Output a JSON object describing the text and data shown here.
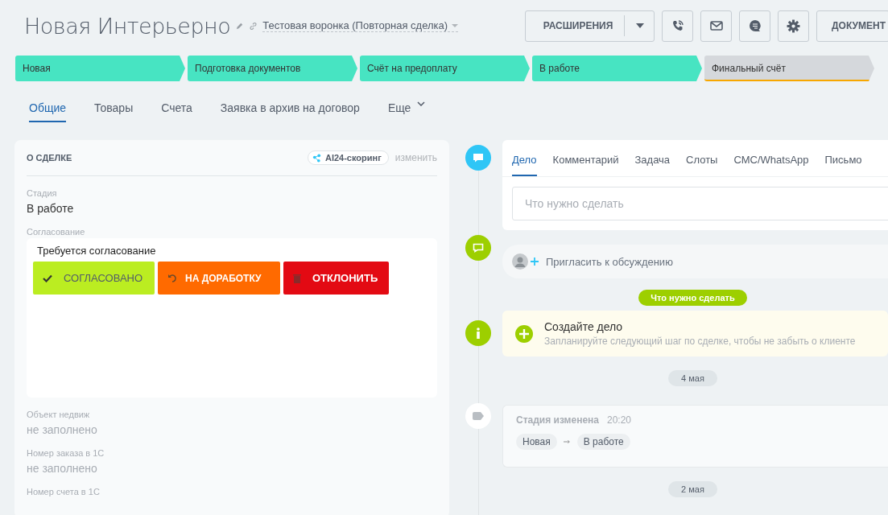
{
  "header": {
    "title": "Новая Интерьерно",
    "funnel": "Тестовая воронка (Повторная сделка)",
    "toolbar": [
      {
        "kind": "split",
        "label": "РАСШИРЕНИЯ"
      },
      {
        "kind": "phone"
      },
      {
        "kind": "mail"
      },
      {
        "kind": "chat"
      },
      {
        "kind": "settings"
      },
      {
        "kind": "text",
        "label": "ДОКУМЕНТ"
      }
    ]
  },
  "stages": [
    {
      "label": "Новая",
      "reached": true
    },
    {
      "label": "Подготовка документов",
      "reached": true
    },
    {
      "label": "Счёт на предоплату",
      "reached": true
    },
    {
      "label": "В работе",
      "reached": true
    },
    {
      "label": "Финальный счёт",
      "reached": false
    }
  ],
  "tabs": [
    {
      "label": "Общие",
      "selected": true
    },
    {
      "label": "Товары",
      "selected": false
    },
    {
      "label": "Счета",
      "selected": false
    },
    {
      "label": "Заявка в архив на договор",
      "selected": false
    },
    {
      "label": "Еще",
      "selected": false,
      "dropdown": true
    }
  ],
  "deal_card": {
    "title": "О СДЕЛКЕ",
    "scoring": "AI24-скоринг",
    "edit": "изменить",
    "fields": [
      {
        "kind": "text",
        "label": "Стадия",
        "value": "В работе",
        "empty": false
      },
      {
        "kind": "approval",
        "label": "Согласование",
        "note": "Требуется согласование",
        "buttons": [
          {
            "kind": "approve",
            "label": "СОГЛАСОВАНО"
          },
          {
            "kind": "rework",
            "label": "НА ДОРАБОТКУ"
          },
          {
            "kind": "reject",
            "label": "ОТКЛОНИТЬ"
          }
        ]
      },
      {
        "kind": "text",
        "label": "Объект недвиж",
        "value": "не заполнено",
        "empty": true
      },
      {
        "kind": "text",
        "label": "Номер заказа в 1С",
        "value": "не заполнено",
        "empty": true
      },
      {
        "kind": "text",
        "label": "Номер счета в 1С"
      }
    ]
  },
  "timeline": [
    {
      "kind": "editor",
      "tabs": [
        {
          "label": "Дело",
          "selected": true
        },
        {
          "label": "Комментарий",
          "selected": false
        },
        {
          "label": "Задача",
          "selected": false
        },
        {
          "label": "Слоты",
          "selected": false
        },
        {
          "label": "СМС/WhatsApp",
          "selected": false
        },
        {
          "label": "Письмо",
          "selected": false
        }
      ],
      "placeholder": "Что нужно сделать"
    },
    {
      "kind": "invite",
      "text": "Пригласить к обсуждению"
    },
    {
      "kind": "section",
      "label": "Что нужно сделать"
    },
    {
      "kind": "todo",
      "title": "Создайте дело",
      "text": "Запланируйте следующий шаг по сделке, чтобы не забыть о клиенте"
    },
    {
      "kind": "date",
      "label": "4 мая"
    },
    {
      "kind": "history",
      "title": "Стадия изменена",
      "time": "20:20",
      "from": "Новая",
      "to": "В работе"
    },
    {
      "kind": "date",
      "label": "2 мая"
    }
  ]
}
